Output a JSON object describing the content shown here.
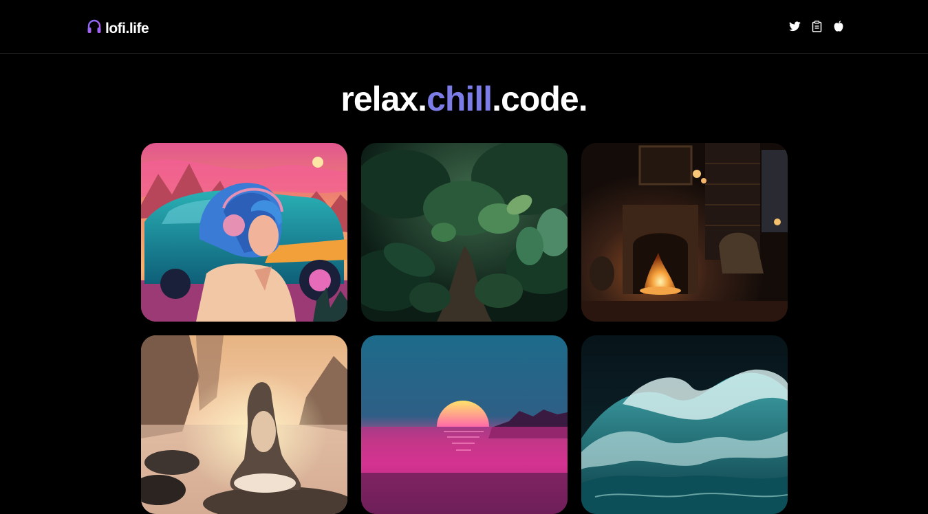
{
  "brand": {
    "name": "lofi.life",
    "icon": "headphones-icon",
    "accent_color": "#7c7ce6"
  },
  "nav": {
    "icons": [
      "twitter-icon",
      "clipboard-icon",
      "apple-icon"
    ]
  },
  "hero": {
    "part1": "relax.",
    "part2": "chill",
    "part3": ".code."
  },
  "scenes": [
    {
      "name": "retro-car-girl-scene"
    },
    {
      "name": "jungle-path-scene"
    },
    {
      "name": "fireplace-library-scene"
    },
    {
      "name": "meditation-lake-scene"
    },
    {
      "name": "synthwave-sunset-scene"
    },
    {
      "name": "ocean-wave-scene"
    }
  ]
}
